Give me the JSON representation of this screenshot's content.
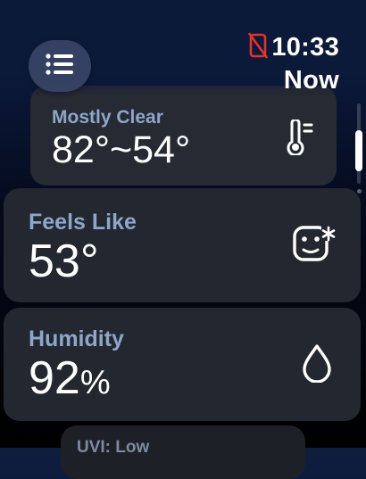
{
  "status": {
    "time": "10:33",
    "context": "Now",
    "phone_icon": "phone-disconnected-icon",
    "alert_color": "#e0342c"
  },
  "menu": {
    "icon": "list-icon"
  },
  "cards": {
    "temperature": {
      "label": "Mostly Clear",
      "value": "82°~54°",
      "icon": "thermometer-icon"
    },
    "feels_like": {
      "label": "Feels Like",
      "value": "53°",
      "icon": "face-snowflake-icon"
    },
    "humidity": {
      "label": "Humidity",
      "value": "92",
      "unit": "%",
      "icon": "droplet-icon"
    },
    "uv": {
      "label": "UVI: Low"
    }
  },
  "colors": {
    "card_background": "#23272f",
    "label": "#8ea6c8",
    "menu_button": "#3a4466"
  }
}
